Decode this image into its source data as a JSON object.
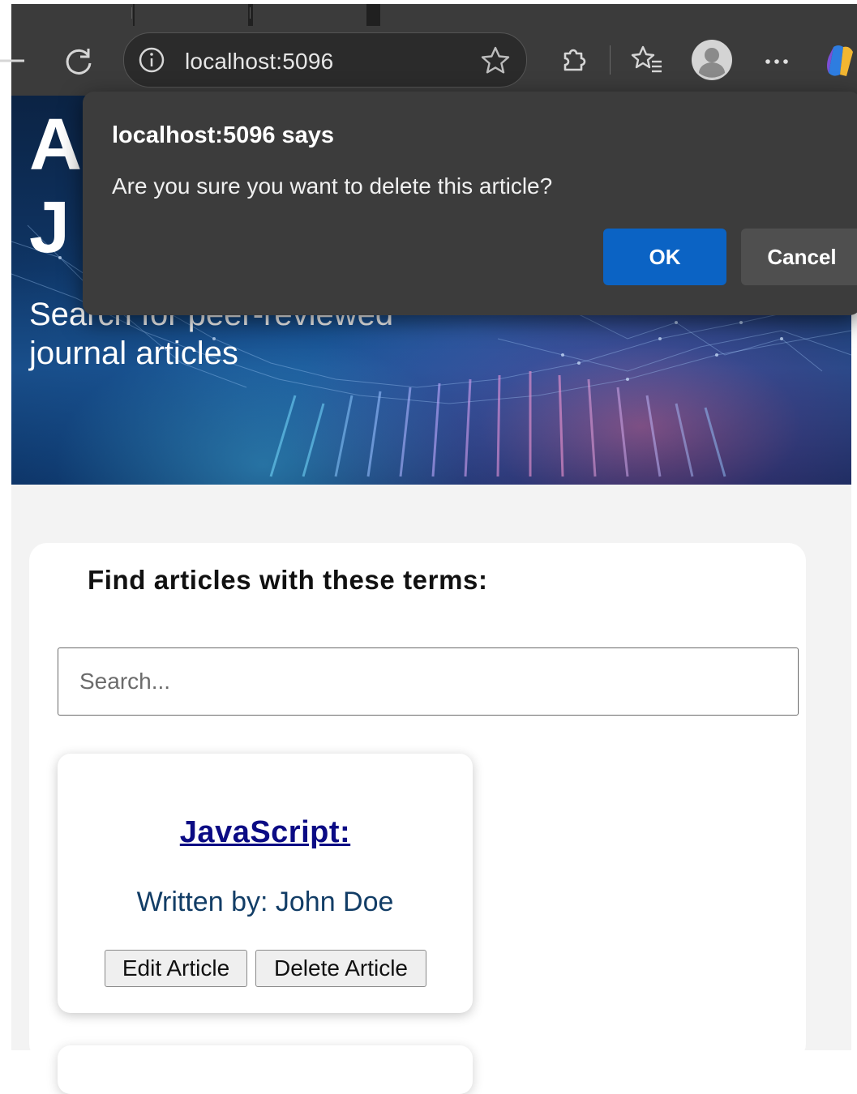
{
  "browser": {
    "address": "localhost:5096",
    "icons": {
      "back": "back-arrow-icon",
      "refresh": "refresh-icon",
      "site_info": "info-icon",
      "favorite": "star-icon",
      "extensions": "puzzle-icon",
      "favorites": "favorites-list-icon",
      "profile": "profile-avatar-icon",
      "more": "ellipsis-icon",
      "copilot": "copilot-icon"
    },
    "colors": {
      "chrome": "#3b3b3b",
      "tabstrip": "#202020"
    }
  },
  "hero": {
    "title_partial_line1": "A",
    "title_partial_line2": "J",
    "subtitle": "Search for peer-reviewed journal articles"
  },
  "search": {
    "heading": "Find articles with these terms:",
    "placeholder": "Search..."
  },
  "articles": [
    {
      "title": "JavaScript:",
      "author": "Written by: John Doe",
      "edit_label": "Edit Article",
      "delete_label": "Delete Article"
    }
  ],
  "dialog": {
    "title": "localhost:5096 says",
    "message": "Are you sure you want to delete this article?",
    "ok_label": "OK",
    "cancel_label": "Cancel",
    "colors": {
      "ok": "#0b63c4",
      "background": "#3c3c3c"
    }
  }
}
